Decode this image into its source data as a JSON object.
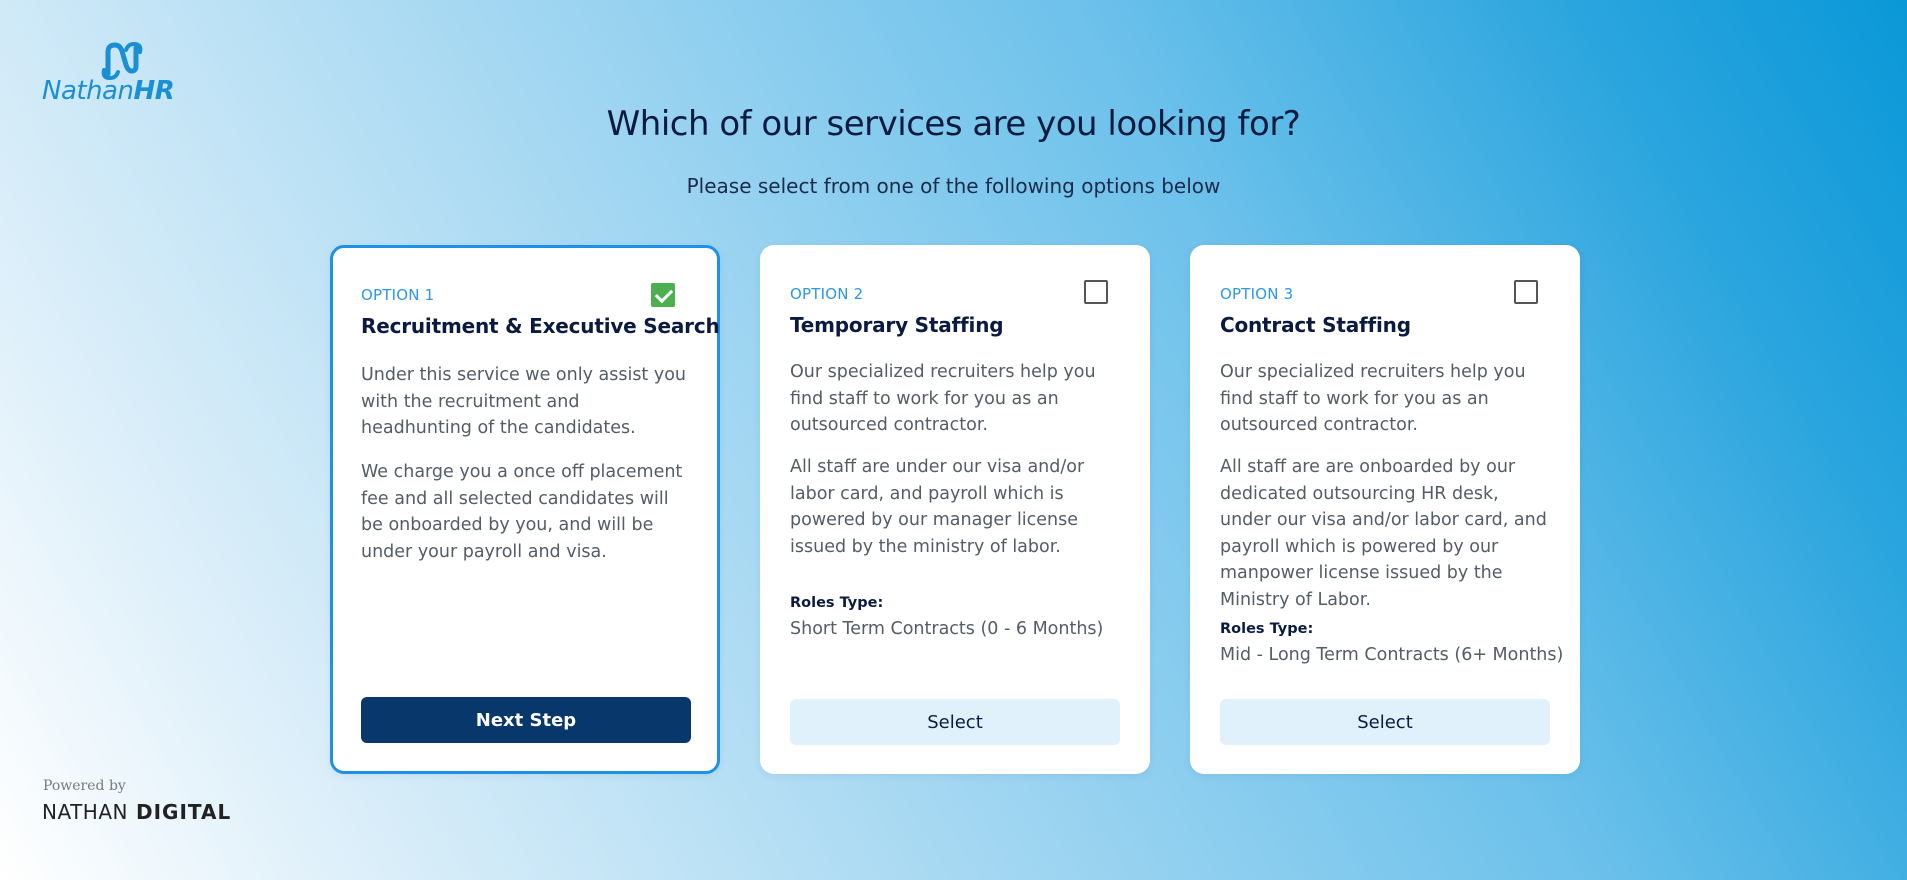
{
  "logo": {
    "text_regular": "Nathan",
    "text_bold": "HR",
    "icon": "nathan-n-logo-icon"
  },
  "heading": "Which of our services are you looking for?",
  "subheading": "Please select from one of the following options below",
  "colors": {
    "accent": "#1e90e6",
    "primary_button": "#08376b",
    "select_button": "#e1f1fc",
    "check": "#4caf50",
    "option_label": "#2c97e8"
  },
  "cards": [
    {
      "option": "OPTION 1",
      "title": "Recruitment & Executive Search",
      "checked": true,
      "desc1": "Under this service we only assist you with the recruitment and headhunting of the candidates.",
      "desc2": "We charge you a once off placement fee and all selected candidates will be onboarded by you, and will be under your payroll and visa.",
      "button": "Next Step"
    },
    {
      "option": "OPTION 2",
      "title": "Temporary Staffing",
      "checked": false,
      "desc1": "Our specialized recruiters help you find staff to work for you as an outsourced contractor.",
      "desc2": "All staff are under our visa and/or labor card, and payroll which is powered by our manager license issued by the ministry of labor.",
      "roles_label": "Roles Type:",
      "roles_value": "Short Term Contracts (0 - 6 Months)",
      "button": "Select"
    },
    {
      "option": "OPTION 3",
      "title": "Contract Staffing",
      "checked": false,
      "desc1": "Our specialized recruiters help you find staff to work for you as an outsourced contractor.",
      "desc2": "All staff are are onboarded by our dedicated outsourcing HR desk, under our visa and/or labor card, and payroll which is powered by our manpower license issued by the Ministry of Labor.",
      "roles_label": "Roles Type:",
      "roles_value": "Mid - Long Term Contracts (6+ Months)",
      "button": "Select"
    }
  ],
  "footer": {
    "powered_by": "Powered by",
    "brand_regular": "NATHAN",
    "brand_bold": "DIGITAL"
  }
}
